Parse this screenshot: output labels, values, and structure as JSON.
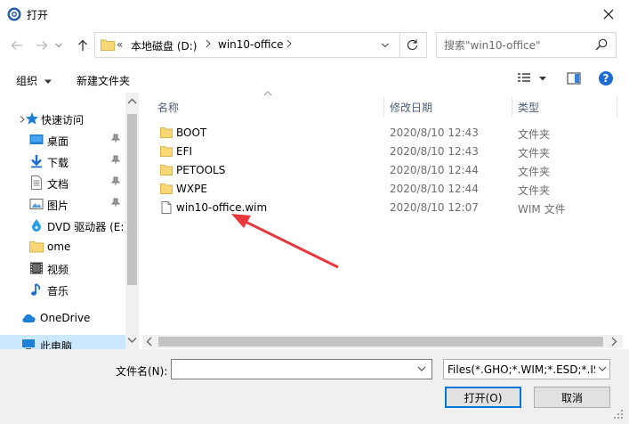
{
  "window": {
    "title": "打开"
  },
  "address": {
    "breadcrumb": [
      "本地磁盘 (D:)",
      "win10-office"
    ],
    "overflow": "«"
  },
  "search": {
    "placeholder": "搜索\"win10-office\""
  },
  "toolbar": {
    "organize_label": "组织",
    "new_folder_label": "新建文件夹"
  },
  "nav_pane": {
    "items": [
      {
        "label": "快速访问",
        "icon": "star-icon",
        "pinned": false
      },
      {
        "label": "桌面",
        "icon": "desktop-icon",
        "pinned": true
      },
      {
        "label": "下载",
        "icon": "download-icon",
        "pinned": true
      },
      {
        "label": "文档",
        "icon": "document-icon",
        "pinned": true
      },
      {
        "label": "图片",
        "icon": "pictures-icon",
        "pinned": true
      },
      {
        "label": "DVD 驱动器 (E:)",
        "icon": "dvd-icon",
        "pinned": false
      },
      {
        "label": "ome",
        "icon": "folder-icon",
        "pinned": false
      },
      {
        "label": "视频",
        "icon": "video-icon",
        "pinned": false
      },
      {
        "label": "音乐",
        "icon": "music-icon",
        "pinned": false
      },
      {
        "label": "OneDrive",
        "icon": "onedrive-icon",
        "pinned": false
      },
      {
        "label": "此电脑",
        "icon": "computer-icon",
        "pinned": false
      }
    ]
  },
  "file_list": {
    "columns": {
      "name": "名称",
      "date": "修改日期",
      "type": "类型"
    },
    "rows": [
      {
        "name": "BOOT",
        "date": "2020/8/10 12:43",
        "type": "文件夹",
        "icon": "folder-icon"
      },
      {
        "name": "EFI",
        "date": "2020/8/10 12:43",
        "type": "文件夹",
        "icon": "folder-icon"
      },
      {
        "name": "PETOOLS",
        "date": "2020/8/10 12:44",
        "type": "文件夹",
        "icon": "folder-icon"
      },
      {
        "name": "WXPE",
        "date": "2020/8/10 12:44",
        "type": "文件夹",
        "icon": "folder-icon"
      },
      {
        "name": "win10-office.wim",
        "date": "2020/8/10 12:07",
        "type": "WIM 文件",
        "icon": "file-icon"
      }
    ]
  },
  "bottom": {
    "filename_label": "文件名(N):",
    "filename_value": "",
    "filter_value": "Files(*.GHO;*.WIM;*.ESD;*.ISO)",
    "open_label": "打开(O)",
    "cancel_label": "取消"
  },
  "colors": {
    "accent": "#0078d7",
    "folder": "#f8d775",
    "annotation": "#e8383d"
  }
}
